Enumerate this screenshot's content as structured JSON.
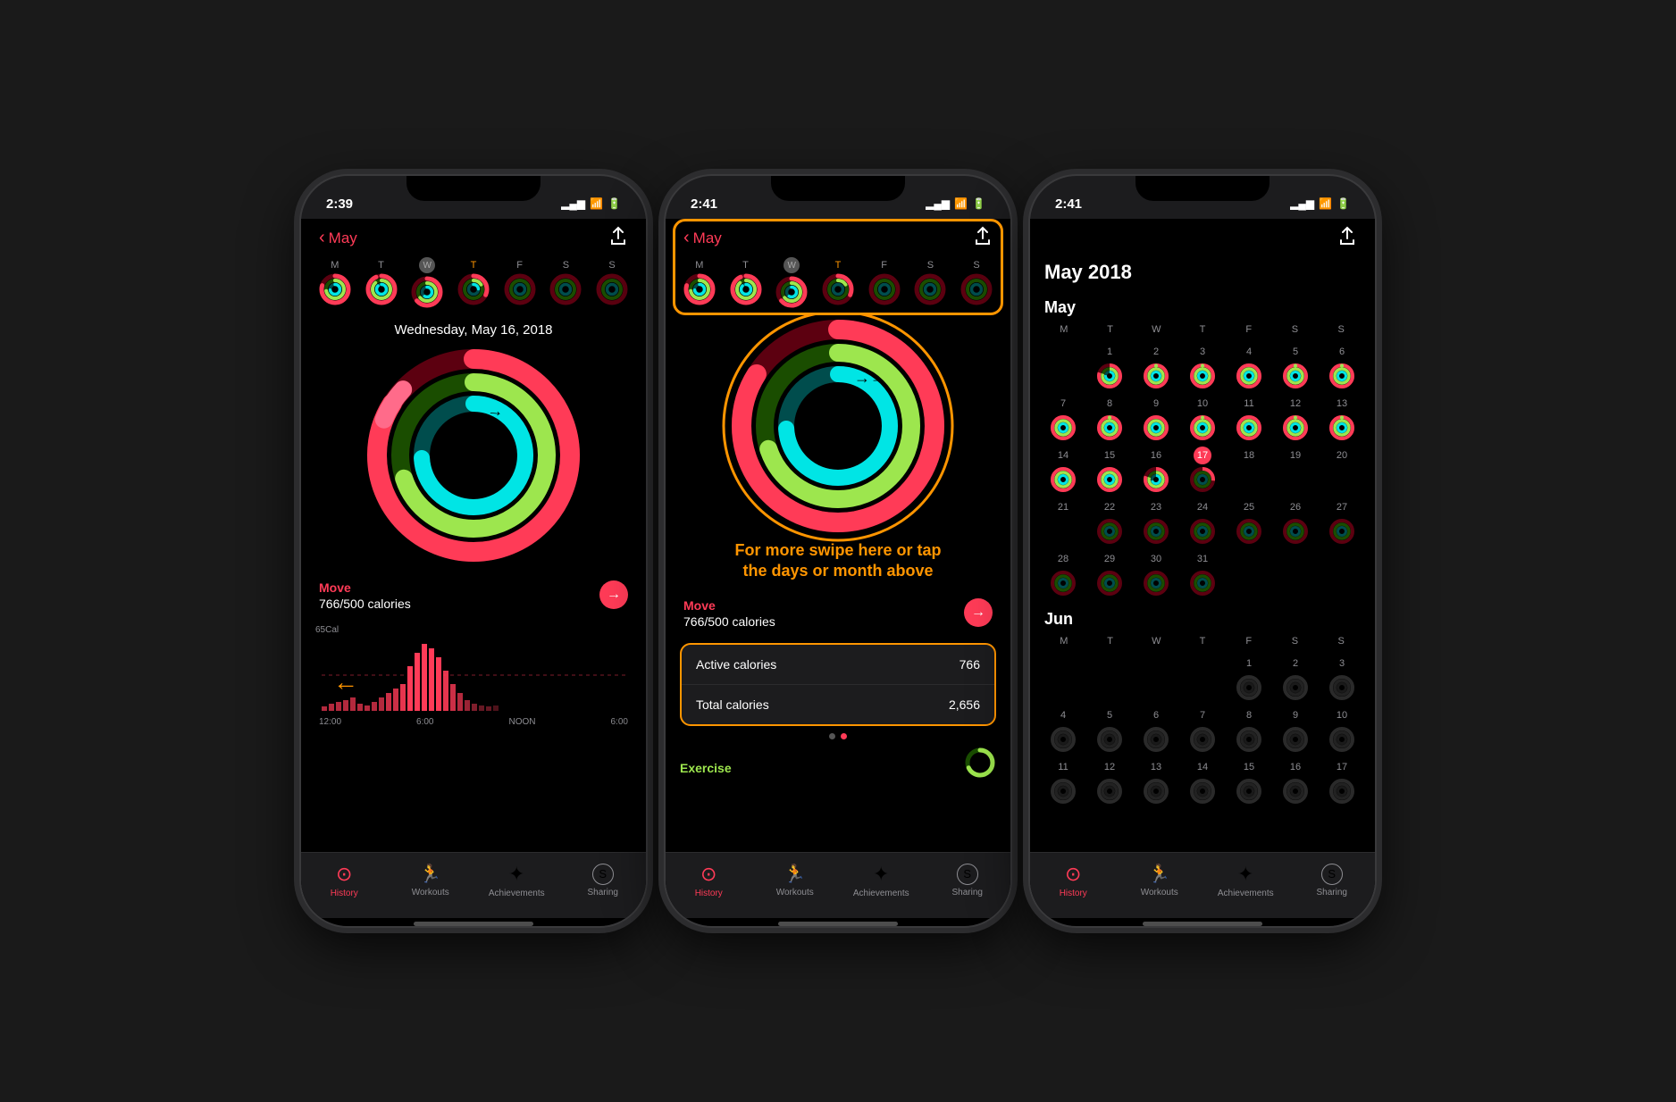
{
  "phones": [
    {
      "id": "phone1",
      "time": "2:39",
      "nav": {
        "back_label": "May",
        "share_icon": "↑"
      },
      "weekdays": [
        "M",
        "T",
        "W",
        "T",
        "F",
        "S",
        "S"
      ],
      "date_label": "Wednesday, May 16, 2018",
      "move": {
        "label": "Move",
        "value": "766/500 calories"
      },
      "chart_label_left": "12:00",
      "chart_label_mid1": "6:00",
      "chart_label_mid2": "NOON",
      "chart_label_right": "6:00",
      "tabs": [
        {
          "label": "History",
          "active": true
        },
        {
          "label": "Workouts",
          "active": false
        },
        {
          "label": "Achievements",
          "active": false
        },
        {
          "label": "Sharing",
          "active": false
        }
      ]
    },
    {
      "id": "phone2",
      "time": "2:41",
      "nav": {
        "back_label": "May",
        "share_icon": "↑"
      },
      "weekdays": [
        "M",
        "T",
        "W",
        "T",
        "F",
        "S",
        "S"
      ],
      "move": {
        "label": "Move",
        "value": "766/500 calories"
      },
      "annotation_text": "For more swipe here or tap the days or month above",
      "stats": [
        {
          "label": "Active calories",
          "value": "766"
        },
        {
          "label": "Total calories",
          "value": "2,656"
        }
      ],
      "exercise_label": "Exercise",
      "tabs": [
        {
          "label": "History",
          "active": true
        },
        {
          "label": "Workouts",
          "active": false
        },
        {
          "label": "Achievements",
          "active": false
        },
        {
          "label": "Sharing",
          "active": false
        }
      ],
      "dots": [
        false,
        true
      ]
    },
    {
      "id": "phone3",
      "time": "2:41",
      "nav": {
        "back_label": "",
        "share_icon": "↑"
      },
      "cal_title": "May 2018",
      "months": [
        {
          "name": "May",
          "weekdays": [
            "M",
            "T",
            "W",
            "T",
            "F",
            "S",
            "S"
          ],
          "weeks": [
            [
              "",
              "1",
              "2",
              "3",
              "4",
              "5",
              "6"
            ],
            [
              "7",
              "8",
              "9",
              "10",
              "11",
              "12",
              "13"
            ],
            [
              "14",
              "15",
              "16",
              "17",
              "18",
              "19",
              "20"
            ],
            [
              "21",
              "22",
              "23",
              "24",
              "25",
              "26",
              "27"
            ],
            [
              "28",
              "29",
              "30",
              "31",
              "",
              "",
              ""
            ]
          ]
        },
        {
          "name": "Jun",
          "weekdays": [
            "M",
            "T",
            "W",
            "T",
            "F",
            "S",
            "S"
          ],
          "weeks": [
            [
              "",
              "",
              "",
              "",
              "1",
              "2",
              "3"
            ],
            [
              "4",
              "5",
              "6",
              "7",
              "8",
              "9",
              "10"
            ],
            [
              "11",
              "12",
              "13",
              "14",
              "15",
              "16",
              "17"
            ]
          ]
        }
      ],
      "today_date": "17",
      "tabs": [
        {
          "label": "History",
          "active": true
        },
        {
          "label": "Workouts",
          "active": false
        },
        {
          "label": "Achievements",
          "active": false
        },
        {
          "label": "Sharing",
          "active": false
        }
      ]
    }
  ],
  "tab_icons": {
    "History": "◎",
    "Workouts": "🏃",
    "Achievements": "★",
    "Sharing": "S"
  }
}
